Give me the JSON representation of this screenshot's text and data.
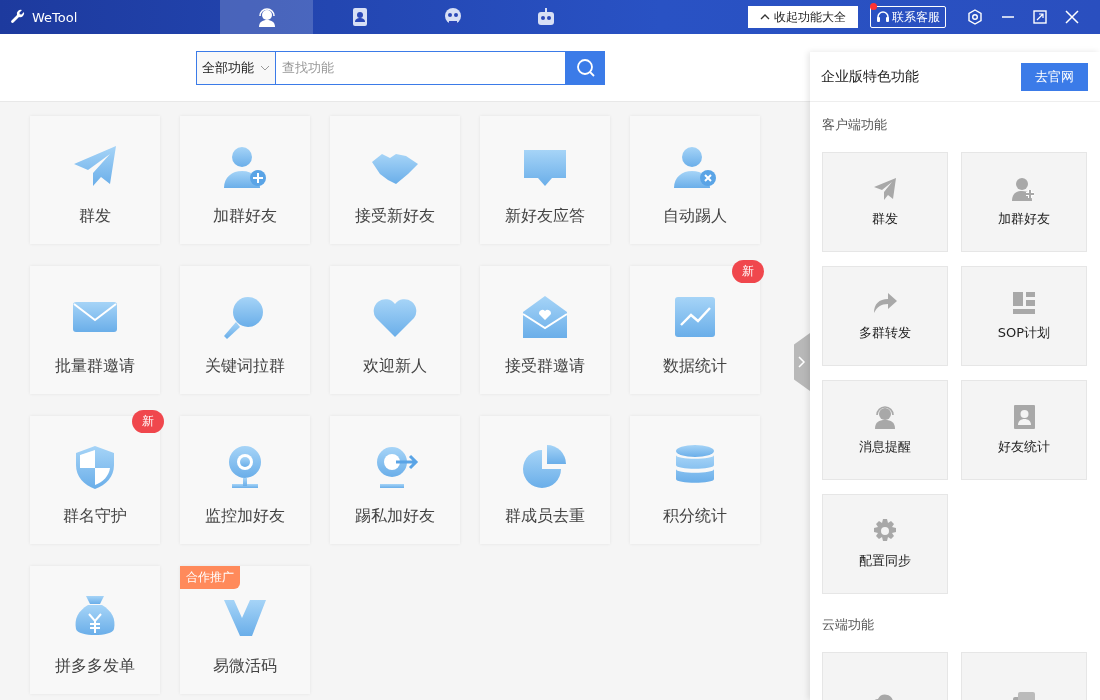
{
  "app": {
    "title": "WeTool"
  },
  "nav_tabs": [
    {
      "selected": true
    },
    {
      "selected": false
    },
    {
      "selected": false
    },
    {
      "selected": false
    }
  ],
  "header_buttons": {
    "collapse": "收起功能大全",
    "support": "联系客服"
  },
  "search": {
    "category": "全部功能",
    "placeholder": "查找功能"
  },
  "features": [
    {
      "label": "群发"
    },
    {
      "label": "加群好友"
    },
    {
      "label": "接受新好友"
    },
    {
      "label": "新好友应答"
    },
    {
      "label": "自动踢人"
    },
    {
      "label": "批量群邀请"
    },
    {
      "label": "关键词拉群"
    },
    {
      "label": "欢迎新人"
    },
    {
      "label": "接受群邀请"
    },
    {
      "label": "数据统计",
      "badge": {
        "kind": "new",
        "text": "新"
      }
    },
    {
      "label": "群名守护",
      "badge": {
        "kind": "new",
        "text": "新"
      }
    },
    {
      "label": "监控加好友"
    },
    {
      "label": "踢私加好友"
    },
    {
      "label": "群成员去重"
    },
    {
      "label": "积分统计"
    },
    {
      "label": "拼多多发单"
    },
    {
      "label": "易微活码",
      "badge": {
        "kind": "promo",
        "text": "合作推广"
      }
    }
  ],
  "enterprise_panel": {
    "title": "企业版特色功能",
    "button": "去官网",
    "sections": [
      {
        "title": "客户端功能",
        "items": [
          {
            "label": "群发"
          },
          {
            "label": "加群好友"
          },
          {
            "label": "多群转发"
          },
          {
            "label": "SOP计划"
          },
          {
            "label": "消息提醒"
          },
          {
            "label": "好友统计"
          },
          {
            "label": "配置同步"
          }
        ]
      },
      {
        "title": "云端功能",
        "items": [
          {
            "kind": "icon_only"
          },
          {
            "kind": "icon_only"
          }
        ]
      }
    ]
  }
}
